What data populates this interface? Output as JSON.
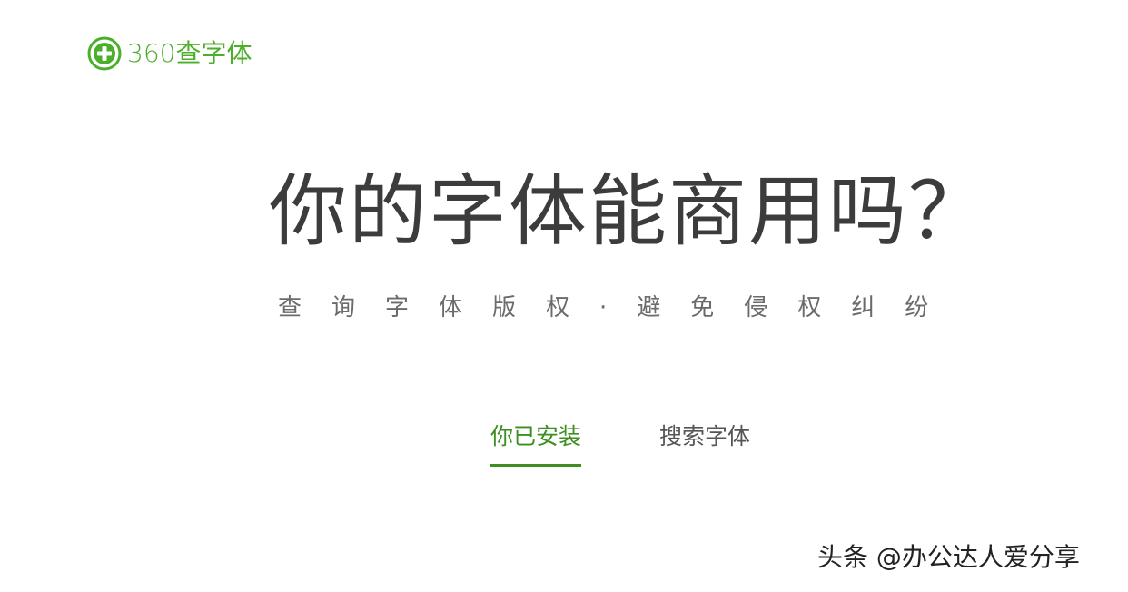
{
  "header": {
    "logo_icon": "green-circle-plus-icon",
    "logo_text": "360查字体",
    "brand_color": "#4caf2a"
  },
  "hero": {
    "title": "你的字体能商用吗？",
    "subtitle": "查询字体版权·避免侵权纠纷"
  },
  "tabs": {
    "installed_label": "你已安装",
    "search_label": "搜索字体",
    "active_tab": "installed",
    "active_color": "#3d8f22"
  },
  "watermark": {
    "text": "头条 @办公达人爱分享"
  }
}
